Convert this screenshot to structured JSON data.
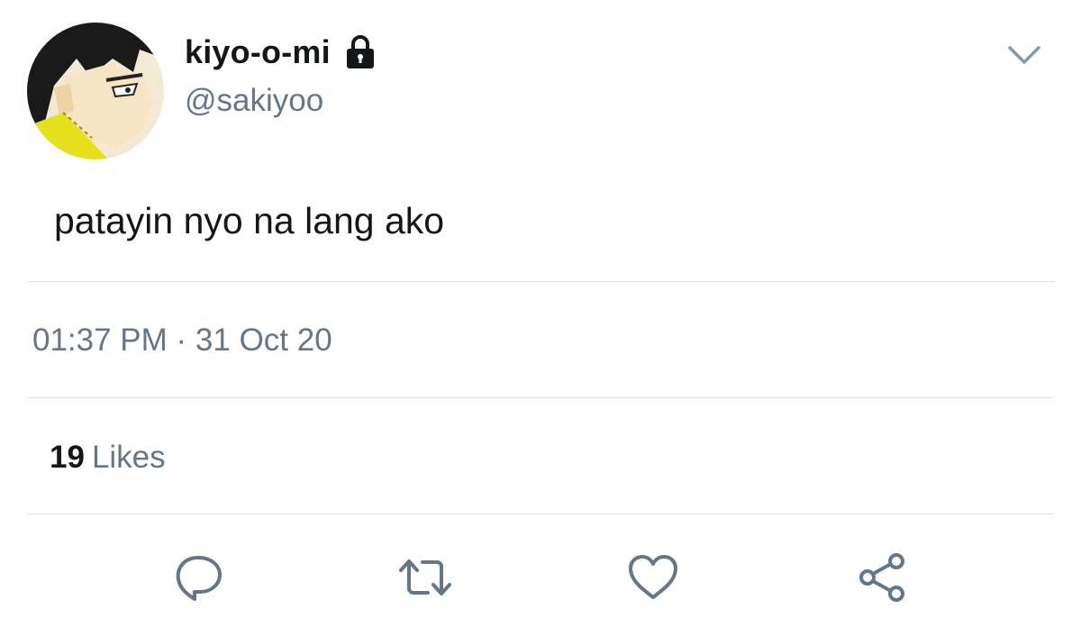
{
  "author": {
    "display_name": "kiyo-o-mi",
    "handle": "@sakiyoo",
    "protected": true
  },
  "tweet": {
    "text": "patayin nyo na lang ako"
  },
  "meta": {
    "timestamp": "01:37 PM · 31 Oct 20"
  },
  "stats": {
    "likes_count": "19",
    "likes_label": "Likes"
  },
  "actions": [
    "reply-icon",
    "retweet-icon",
    "like-icon",
    "share-icon"
  ],
  "colors": {
    "primary_text": "#14171a",
    "secondary_text": "#657786",
    "divider": "#dfe3e7"
  }
}
